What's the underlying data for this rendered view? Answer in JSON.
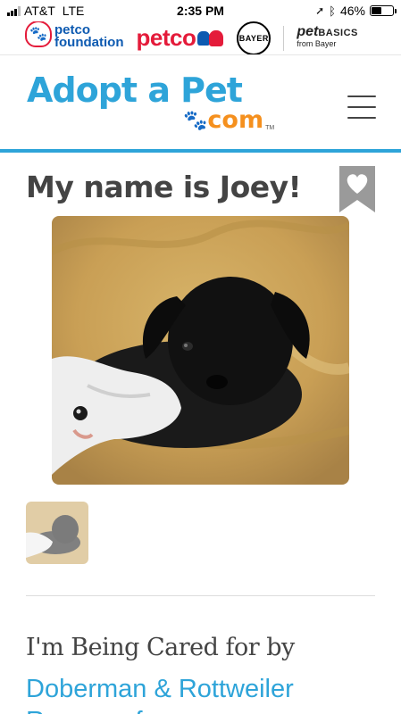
{
  "status_bar": {
    "carrier": "AT&T",
    "network": "LTE",
    "time": "2:35 PM",
    "battery_percent": "46%",
    "battery_level": 0.46,
    "location_icon": "location-arrow-icon",
    "bluetooth_icon": "bluetooth-icon"
  },
  "sponsors": {
    "petco_foundation_line1": "petco",
    "petco_foundation_line2": "foundation",
    "petco": "petco",
    "bayer": "BAYER",
    "petbasics_brand": "pet",
    "petbasics_basics": "BASICS",
    "petbasics_sub": "from Bayer"
  },
  "header": {
    "logo_main": "Adopt a Pet",
    "logo_com": "com",
    "logo_tm": "TM",
    "accent_color": "#2ea4d9",
    "orange_color": "#f5901e"
  },
  "pet": {
    "title": "My name is Joey!"
  },
  "care": {
    "heading": "I'm Being Cared for by",
    "shelter": "Doberman & Rottweiler Rescue of ..."
  }
}
